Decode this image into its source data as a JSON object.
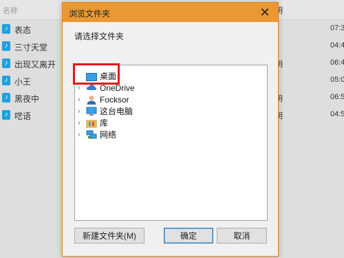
{
  "background_list": {
    "header_name": "名称",
    "rows": [
      {
        "name": "表态",
        "mid": "",
        "duration": "07:3"
      },
      {
        "name": "三寸天堂",
        "mid": "",
        "duration": "04:4"
      },
      {
        "name": "出现又离开",
        "mid": "明",
        "duration": "06:4"
      },
      {
        "name": "小王",
        "mid": "",
        "duration": "05:0"
      },
      {
        "name": "黑夜中",
        "mid": "明",
        "duration": "06:5"
      },
      {
        "name": "呓语",
        "mid": "明",
        "duration": "04:5"
      }
    ],
    "row_mid_top": "明"
  },
  "dialog": {
    "title": "浏览文件夹",
    "close_glyph": "✕",
    "prompt": "请选择文件夹",
    "tree": [
      {
        "label": "桌面",
        "icon": "desktop-icon",
        "expandable": false
      },
      {
        "label": "OneDrive",
        "icon": "cloud-icon",
        "expandable": true
      },
      {
        "label": "Focksor",
        "icon": "user-icon",
        "expandable": true
      },
      {
        "label": "这台电脑",
        "icon": "pc-icon",
        "expandable": true
      },
      {
        "label": "库",
        "icon": "library-icon",
        "expandable": true
      },
      {
        "label": "网络",
        "icon": "network-icon",
        "expandable": true
      }
    ],
    "buttons": {
      "new_folder": "新建文件夹(M)",
      "ok": "确定",
      "cancel": "取消"
    }
  },
  "colors": {
    "titlebar": "#ea9834",
    "highlight_box": "#e2161a",
    "music_icon": "#1fa0e0"
  }
}
